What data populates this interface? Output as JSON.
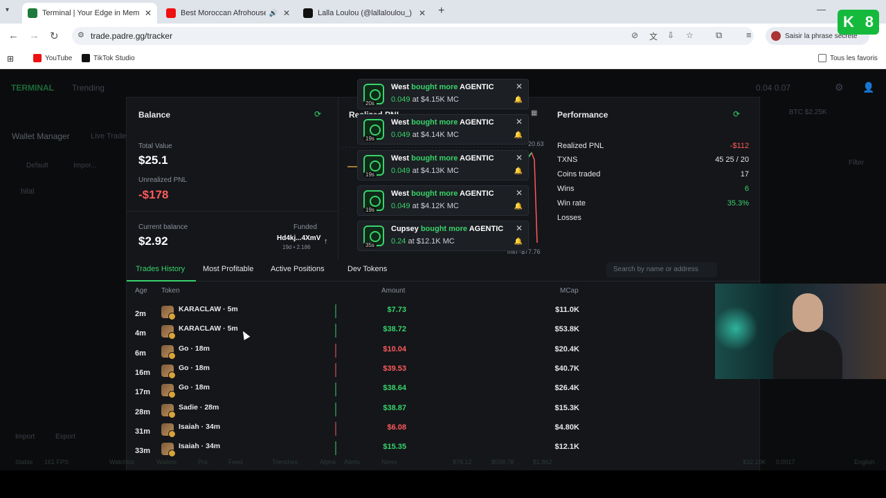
{
  "browser": {
    "tabs": [
      {
        "title": "Terminal | Your Edge in Memecoins",
        "active": true
      },
      {
        "title": "Best Moroccan Afrohouse Mix",
        "active": false
      },
      {
        "title": "Lalla Loulou (@lallaloulou_) est",
        "active": false
      }
    ],
    "url": "trade.padre.gg/tracker",
    "profile_label": "Saisir la phrase secrète",
    "bookmarks": [
      "YouTube",
      "TikTok Studio"
    ],
    "all_bookmarks": "Tous les favoris"
  },
  "app": {
    "nav": [
      "TERMINAL",
      "Trending"
    ],
    "wallet_manager": "Wallet Manager",
    "live_trades": "Live Trades",
    "default": "Default",
    "import_chip": "Impor...",
    "wallet": "hilal",
    "import": "Import",
    "export": "Export",
    "filter": "Filter",
    "btc_price": "BTC $2.25K",
    "right_top": "0.04  0.07"
  },
  "balance": {
    "title": "Balance",
    "total_value_label": "Total Value",
    "total_value": "$25.1",
    "unrealized_label": "Unrealized PNL",
    "unrealized": "-$178",
    "current_label": "Current balance",
    "current": "$2.92",
    "funded_label": "Funded",
    "funded_addr": "Hd4kj...4XmV",
    "funded_meta": "19d • 2.186"
  },
  "pnl": {
    "title": "Realized PNL",
    "max": "20.63",
    "min": "min -$77.76"
  },
  "performance": {
    "title": "Performance",
    "rows": [
      {
        "label": "Realized PNL",
        "value": "-$112",
        "color": "#ff5b5b"
      },
      {
        "label": "TXNS",
        "value": "45 25 / 20",
        "color": "#e5e5e5"
      },
      {
        "label": "Coins traded",
        "value": "17",
        "color": "#e5e5e5"
      },
      {
        "label": "Wins",
        "value": "6",
        "color": "#38d46a"
      },
      {
        "label": "Win rate",
        "value": "35.3%",
        "color": "#38d46a"
      },
      {
        "label": "Losses",
        "value": "",
        "color": "#e5e5e5"
      }
    ]
  },
  "tabs": {
    "items": [
      "Trades History",
      "Most Profitable",
      "Active Positions",
      "Dev Tokens"
    ],
    "search_placeholder": "Search by name or address"
  },
  "table": {
    "headers": {
      "age": "Age",
      "token": "Token",
      "amount": "Amount",
      "mcap": "MCap"
    },
    "rows": [
      {
        "age": "2m",
        "token": "KARACLAW · 5m",
        "amount": "$7.73",
        "mcap": "$11.0K",
        "side": "buy"
      },
      {
        "age": "4m",
        "token": "KARACLAW · 5m",
        "amount": "$38.72",
        "mcap": "$53.8K",
        "side": "buy"
      },
      {
        "age": "6m",
        "token": "Go · 18m",
        "amount": "$10.04",
        "mcap": "$20.4K",
        "side": "sell"
      },
      {
        "age": "16m",
        "token": "Go · 18m",
        "amount": "$39.53",
        "mcap": "$40.7K",
        "side": "sell"
      },
      {
        "age": "17m",
        "token": "Go · 18m",
        "amount": "$38.64",
        "mcap": "$26.4K",
        "side": "buy"
      },
      {
        "age": "28m",
        "token": "Sadie · 28m",
        "amount": "$38.87",
        "mcap": "$15.3K",
        "side": "buy"
      },
      {
        "age": "31m",
        "token": "Isaiah · 34m",
        "amount": "$6.08",
        "mcap": "$4.80K",
        "side": "sell"
      },
      {
        "age": "33m",
        "token": "Isaiah · 34m",
        "amount": "$15.35",
        "mcap": "$12.1K",
        "side": "buy"
      }
    ]
  },
  "notifications": [
    {
      "age": "20s",
      "who": "West",
      "action": "bought more",
      "token": "AGENTIC",
      "amount": "0.049",
      "mc": "at $4.15K MC"
    },
    {
      "age": "19s",
      "who": "West",
      "action": "bought more",
      "token": "AGENTIC",
      "amount": "0.049",
      "mc": "at $4.14K MC"
    },
    {
      "age": "19s",
      "who": "West",
      "action": "bought more",
      "token": "AGENTIC",
      "amount": "0.049",
      "mc": "at $4.13K MC"
    },
    {
      "age": "19s",
      "who": "West",
      "action": "bought more",
      "token": "AGENTIC",
      "amount": "0.049",
      "mc": "at $4.12K MC"
    },
    {
      "age": "35s",
      "who": "Cupsey",
      "action": "bought more",
      "token": "AGENTIC",
      "amount": "0.24",
      "mc": "at $12.1K MC"
    }
  ],
  "status": {
    "items": [
      "Stable",
      "161 FPS",
      "Watchlist",
      "Wallets",
      "PnL",
      "Feed",
      "Trenches",
      "Alpha",
      "Alerts",
      "News",
      "$78.12",
      "$598.78",
      "$1,862",
      "$32.10K",
      "0.0017",
      "English"
    ]
  },
  "colors": {
    "accent": "#38d46a",
    "loss": "#ff5b5b"
  }
}
